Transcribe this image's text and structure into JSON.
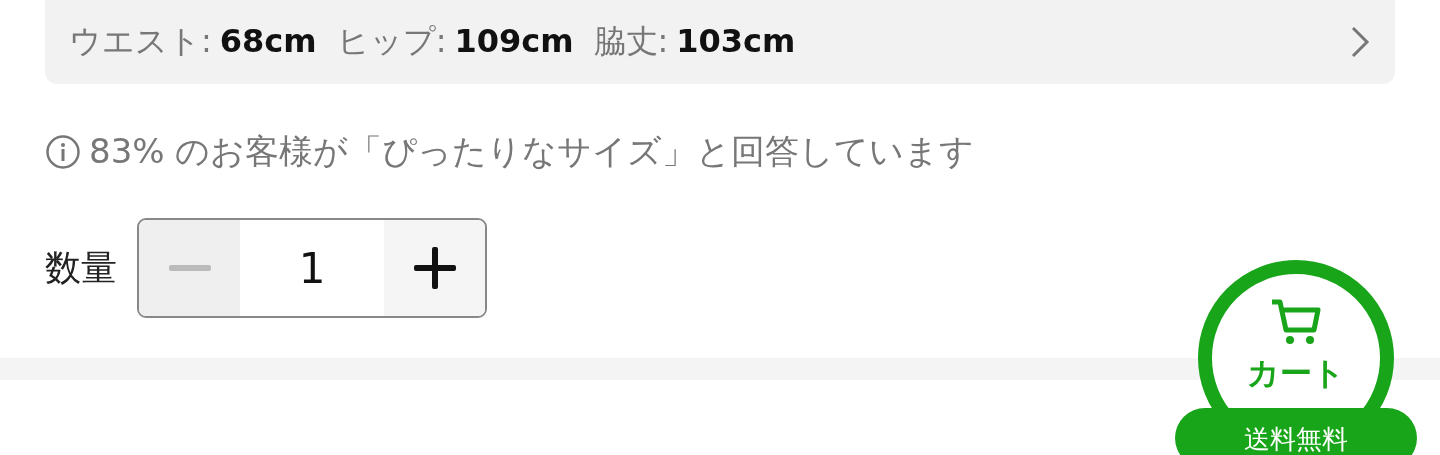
{
  "size_summary": {
    "items": [
      {
        "label": "ウエスト:",
        "value": "68cm"
      },
      {
        "label": "ヒップ:",
        "value": "109cm"
      },
      {
        "label": "脇丈:",
        "value": "103cm"
      }
    ]
  },
  "fit_note": {
    "text": "83% のお客様が「ぴったりなサイズ」と回答しています"
  },
  "quantity": {
    "label": "数量",
    "value": "1",
    "decrease_disabled": true,
    "increase_disabled": false
  },
  "cart_button": {
    "label": "カート",
    "badge": "送料無料"
  }
}
